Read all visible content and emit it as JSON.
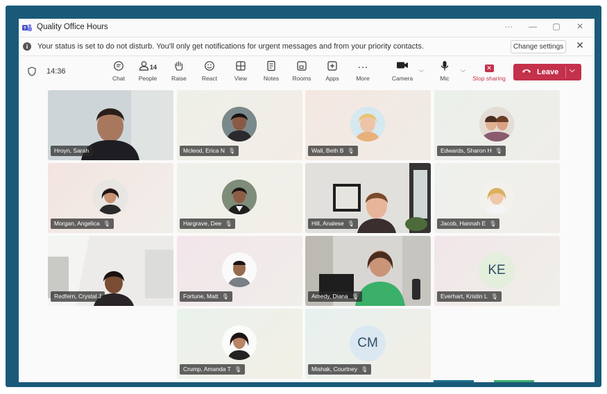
{
  "window": {
    "title": "Quality Office Hours",
    "controls": [
      "···",
      "—",
      "▢",
      "✕"
    ]
  },
  "banner": {
    "message": "Your status is set to do not disturb. You'll only get notifications for urgent messages and from your priority contacts.",
    "change_settings": "Change settings",
    "close": "✕"
  },
  "toolbar": {
    "time": "14:36",
    "chat": "Chat",
    "people": "People",
    "people_count": "14",
    "raise": "Raise",
    "react": "React",
    "view": "View",
    "notes": "Notes",
    "rooms": "Rooms",
    "apps": "Apps",
    "more": "More",
    "camera": "Camera",
    "mic": "Mic",
    "stop_sharing": "Stop sharing",
    "leave": "Leave"
  },
  "participants": [
    {
      "name": "Hroyn, Sarah",
      "kind": "video",
      "muted": false
    },
    {
      "name": "Mcleod, Erica N",
      "kind": "photo",
      "muted": true
    },
    {
      "name": "Wall, Beth B",
      "kind": "photo",
      "muted": true
    },
    {
      "name": "Edwards, Sharon H",
      "kind": "photo",
      "muted": true
    },
    {
      "name": "Morgan, Angelica",
      "kind": "photo",
      "muted": true
    },
    {
      "name": "Hargrave, Dee",
      "kind": "photo",
      "muted": true
    },
    {
      "name": "Hill, Analese",
      "kind": "video",
      "muted": true
    },
    {
      "name": "Jacob, Hannah E",
      "kind": "photo",
      "muted": true
    },
    {
      "name": "Redfern, Crystal J",
      "kind": "video",
      "muted": false
    },
    {
      "name": "Fortune, Matt",
      "kind": "photo",
      "muted": true
    },
    {
      "name": "Amedy, Diana",
      "kind": "video",
      "muted": true
    },
    {
      "name": "Everhart, Kristin L",
      "kind": "initials",
      "initials": "KE",
      "muted": true
    },
    {
      "name": "Crump, Amanda T",
      "kind": "photo",
      "muted": true
    },
    {
      "name": "Mishak, Courtney",
      "kind": "initials",
      "initials": "CM",
      "muted": true
    }
  ],
  "colors": {
    "frame": "#1a5a78",
    "leave": "#c4314b",
    "selected": "#7b83eb"
  }
}
